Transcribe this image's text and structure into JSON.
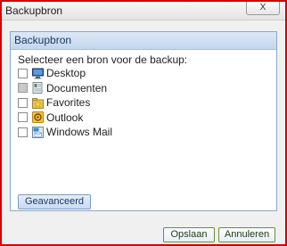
{
  "window": {
    "title": "Backupbron",
    "close_label": "X"
  },
  "panel": {
    "header": "Backupbron",
    "prompt": "Selecteer een bron voor de backup:",
    "items": [
      {
        "label": "Desktop",
        "icon": "desktop-icon",
        "checked": false,
        "disabled": false
      },
      {
        "label": "Documenten",
        "icon": "documents-icon",
        "checked": false,
        "disabled": true
      },
      {
        "label": "Favorites",
        "icon": "favorites-icon",
        "checked": false,
        "disabled": false
      },
      {
        "label": "Outlook",
        "icon": "outlook-icon",
        "checked": false,
        "disabled": false
      },
      {
        "label": "Windows Mail",
        "icon": "windows-mail-icon",
        "checked": false,
        "disabled": false
      }
    ],
    "advanced_label": "Geavanceerd"
  },
  "footer": {
    "save_label": "Opslaan",
    "cancel_label": "Annuleren"
  },
  "colors": {
    "window_border": "#d40000",
    "panel_header_bg": "#c4d6ec",
    "button_border": "#6b8e3a"
  }
}
